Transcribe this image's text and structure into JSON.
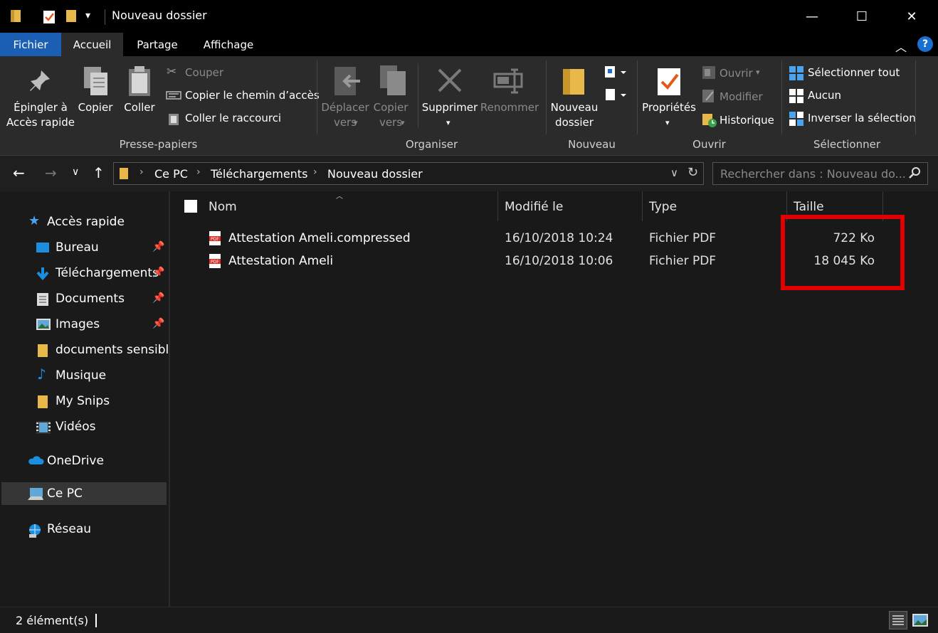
{
  "window": {
    "title": "Nouveau dossier",
    "minimize": "—",
    "maximize": "☐",
    "close": "✕"
  },
  "tabs": {
    "file": "Fichier",
    "home": "Accueil",
    "share": "Partage",
    "view": "Affichage",
    "help": "?"
  },
  "ribbon": {
    "pin_line1": "Épingler à",
    "pin_line2": "Accès rapide",
    "copy": "Copier",
    "paste": "Coller",
    "cut": "Couper",
    "copy_path": "Copier le chemin d’accès",
    "paste_shortcut": "Coller le raccourci",
    "group_clipboard": "Presse-papiers",
    "move_line1": "Déplacer",
    "move_line2": "vers",
    "copyto_line1": "Copier",
    "copyto_line2": "vers",
    "delete": "Supprimer",
    "rename": "Renommer",
    "group_organize": "Organiser",
    "newfolder_line1": "Nouveau",
    "newfolder_line2": "dossier",
    "group_new": "Nouveau",
    "properties": "Propriétés",
    "open": "Ouvrir",
    "edit": "Modifier",
    "history": "Historique",
    "group_open": "Ouvrir",
    "select_all": "Sélectionner tout",
    "select_none": "Aucun",
    "invert_selection": "Inverser la sélection",
    "group_select": "Sélectionner"
  },
  "address": {
    "crumbs": [
      "Ce PC",
      "Téléchargements",
      "Nouveau dossier"
    ],
    "search_placeholder": "Rechercher dans : Nouveau do..."
  },
  "nav": {
    "quick_access": "Accès rapide",
    "items": [
      "Bureau",
      "Téléchargements",
      "Documents",
      "Images",
      "documents sensible",
      "Musique",
      "My Snips",
      "Vidéos"
    ],
    "onedrive": "OneDrive",
    "this_pc": "Ce PC",
    "network": "Réseau"
  },
  "columns": {
    "name": "Nom",
    "modified": "Modifié le",
    "type": "Type",
    "size": "Taille"
  },
  "files": [
    {
      "name": "Attestation Ameli.compressed",
      "modified": "16/10/2018 10:24",
      "type": "Fichier PDF",
      "size": "722 Ko"
    },
    {
      "name": "Attestation Ameli",
      "modified": "16/10/2018 10:06",
      "type": "Fichier PDF",
      "size": "18 045 Ko"
    }
  ],
  "status": {
    "count": "2 élément(s)"
  },
  "colors": {
    "accent": "#1a5fb4",
    "highlight": "#e00000",
    "folder": "#e8b84a",
    "pdf": "#d9322b"
  }
}
